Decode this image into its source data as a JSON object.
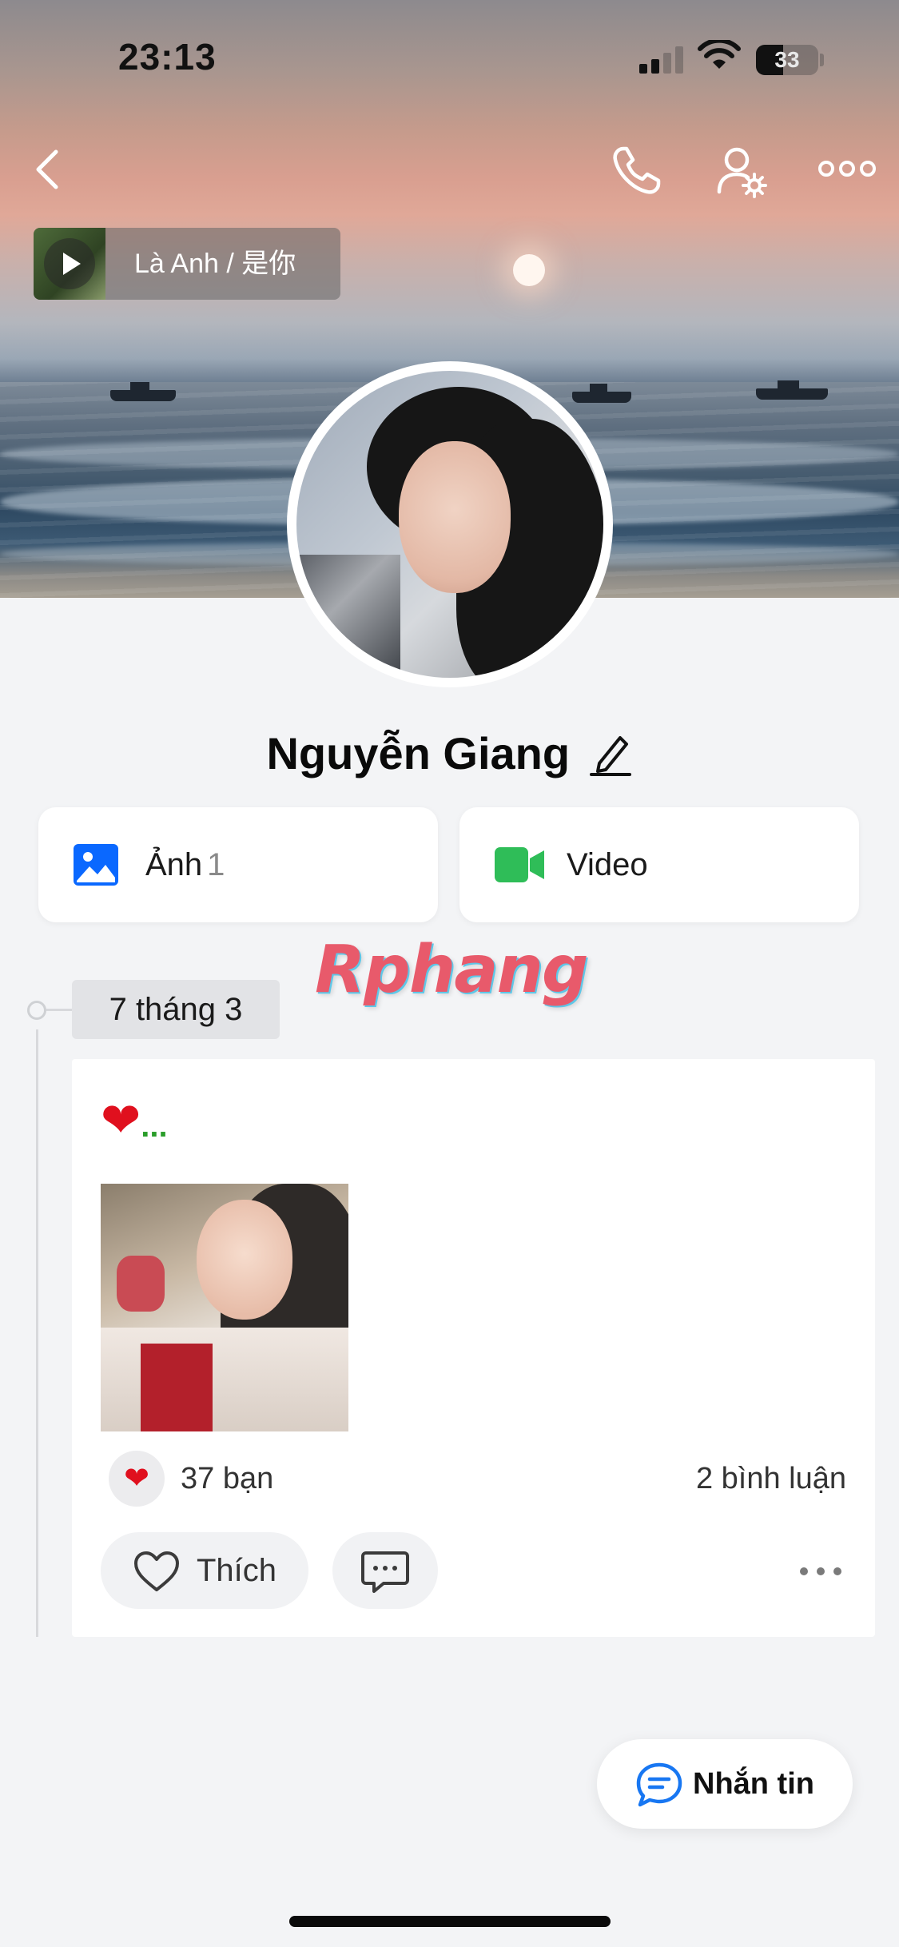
{
  "status_bar": {
    "time": "23:13",
    "battery_level": "33"
  },
  "cover": {
    "music_title": "Là Anh / 是你"
  },
  "icons": {
    "back": "chevron-left-icon",
    "call": "phone-icon",
    "settings": "user-gear-icon",
    "more": "more-horizontal-icon",
    "photo": "image-icon",
    "video": "video-camera-icon",
    "edit": "pencil-icon",
    "like": "heart-outline-icon",
    "comment": "chat-bubble-icon",
    "message": "message-icon"
  },
  "profile": {
    "name": "Nguyễn Giang"
  },
  "media_tabs": {
    "photos_label": "Ảnh",
    "photos_count": "1",
    "videos_label": "Video"
  },
  "watermark": "Rphang",
  "timeline": {
    "date": "7 tháng 3",
    "post": {
      "text_emoji": "❤",
      "text_suffix": "...",
      "reaction_emoji": "❤",
      "reaction_count": "37 bạn",
      "comment_count": "2 bình luận",
      "like_label": "Thích"
    }
  },
  "fab": {
    "label": "Nhắn tin"
  },
  "colors": {
    "accent_blue": "#1877f2",
    "photo_icon_blue": "#0a68ff",
    "video_icon_green": "#2fbd58",
    "heart_red": "#e0101e",
    "background": "#f3f4f6"
  }
}
